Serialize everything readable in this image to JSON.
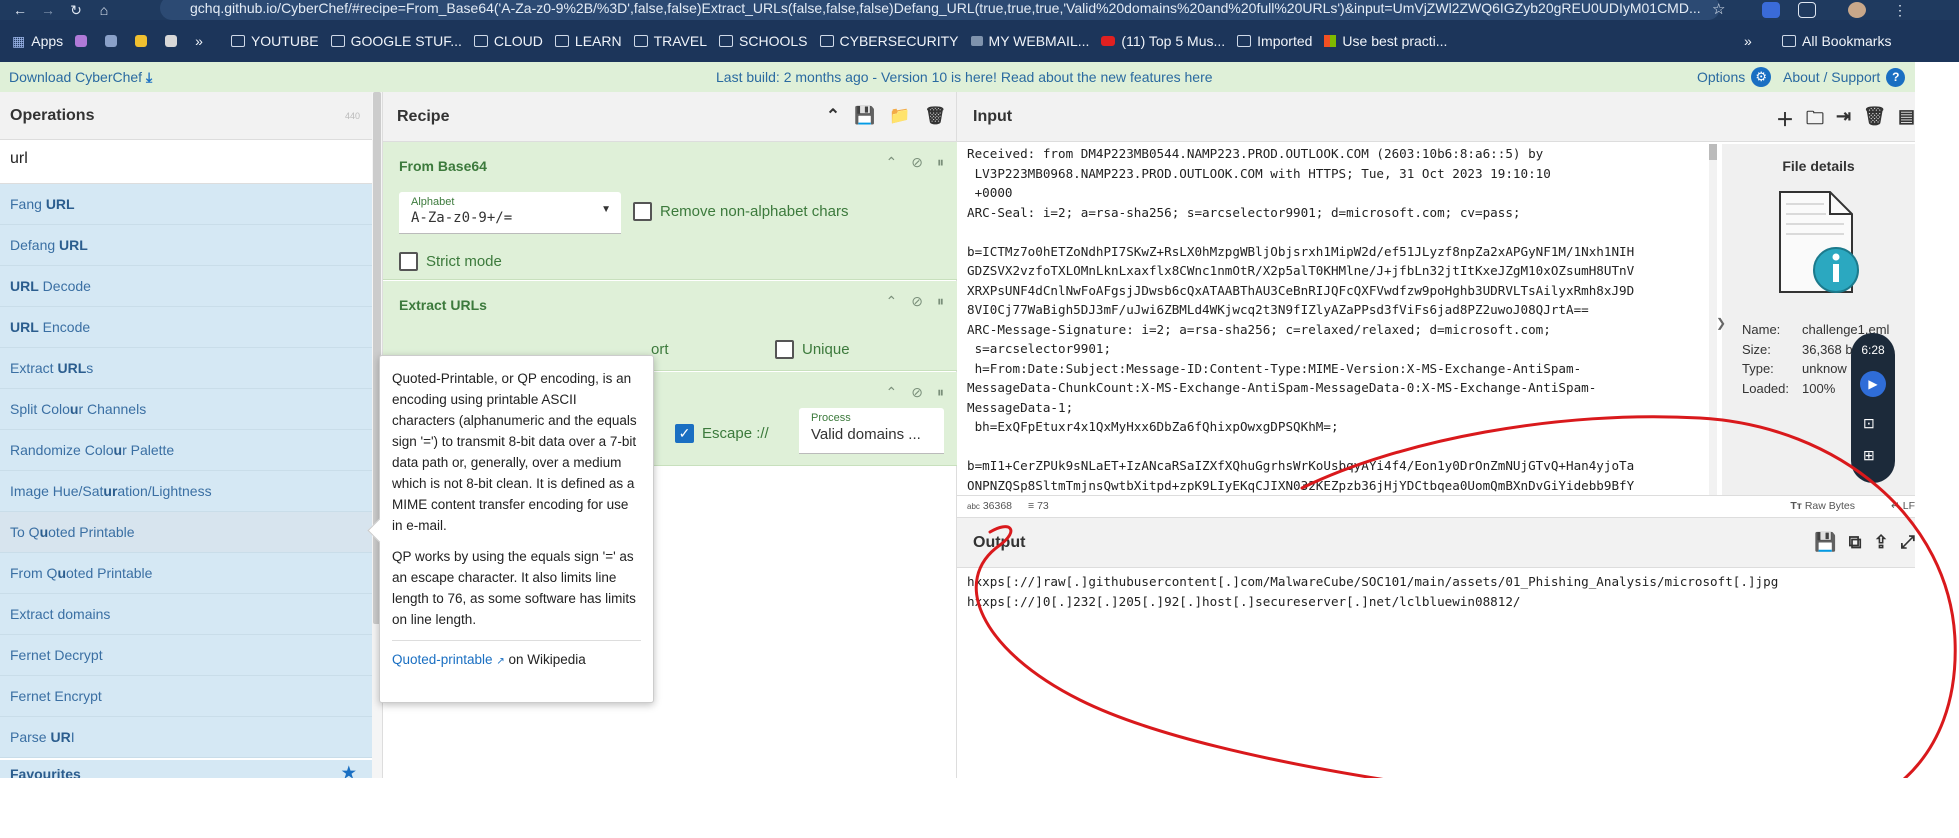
{
  "browser": {
    "url": "gchq.github.io/CyberChef/#recipe=From_Base64('A-Za-z0-9%2B/%3D',false,false)Extract_URLs(false,false,false)Defang_URL(true,true,true,'Valid%20domains%20and%20full%20URLs')&input=UmVjZWl2ZWQ6IGZyb20gREU0UDIyM01CMD..."
  },
  "bookmarks": [
    {
      "label": "Apps"
    },
    {
      "label": "YOUTUBE"
    },
    {
      "label": "GOOGLE STUF..."
    },
    {
      "label": "CLOUD"
    },
    {
      "label": "LEARN"
    },
    {
      "label": "TRAVEL"
    },
    {
      "label": "SCHOOLS"
    },
    {
      "label": "CYBERSECURITY"
    },
    {
      "label": "MY WEBMAIL..."
    },
    {
      "label": "(11) Top 5 Mus..."
    },
    {
      "label": "Imported"
    },
    {
      "label": "Use best practi..."
    },
    {
      "label": "All Bookmarks"
    }
  ],
  "banner": {
    "download": "Download CyberChef",
    "message": "Last build: 2 months ago - Version 10 is here! Read about the new features here",
    "options": "Options",
    "about": "About / Support"
  },
  "operations": {
    "title": "Operations",
    "count": "440",
    "search": "url",
    "items": [
      {
        "pre": "Fang ",
        "match": "URL",
        "post": ""
      },
      {
        "pre": "Defang ",
        "match": "URL",
        "post": ""
      },
      {
        "pre": "",
        "match": "URL",
        "post": " Decode"
      },
      {
        "pre": "",
        "match": "URL",
        "post": " Encode"
      },
      {
        "pre": "Extract ",
        "match": "URL",
        "post": "s"
      },
      {
        "pre": "Split Colo",
        "match": "u",
        "post": "r Channels"
      },
      {
        "pre": "Randomize Colo",
        "match": "u",
        "post": "r Palette"
      },
      {
        "pre": "Image Hue/Sat",
        "match": "ur",
        "post": "ation/Lightness"
      },
      {
        "pre": "To Q",
        "match": "u",
        "post": "oted Printable"
      },
      {
        "pre": "From Q",
        "match": "u",
        "post": "oted Printable"
      },
      {
        "pre": "Extract domains",
        "match": "",
        "post": ""
      },
      {
        "pre": "Fernet Decrypt",
        "match": "",
        "post": ""
      },
      {
        "pre": "Fernet Encrypt",
        "match": "",
        "post": ""
      },
      {
        "pre": "Parse ",
        "match": "UR",
        "post": "I"
      }
    ],
    "favourites": "Favourites"
  },
  "recipe": {
    "title": "Recipe",
    "from_base64": {
      "title": "From Base64",
      "alphabet_label": "Alphabet",
      "alphabet_value": "A-Za-z0-9+/=",
      "remove_label": "Remove non-alphabet chars",
      "strict_label": "Strict mode"
    },
    "extract_urls": {
      "title": "Extract URLs",
      "sort_label": "ort",
      "unique_label": "Unique"
    },
    "defang": {
      "escape_label": "Escape ://",
      "process_label": "Process",
      "process_value": "Valid domains ..."
    }
  },
  "popover": {
    "para1": "Quoted-Printable, or QP encoding, is an encoding using printable ASCII characters (alphanumeric and the equals sign '=') to transmit 8-bit data over a 7-bit data path or, generally, over a medium which is not 8-bit clean. It is defined as a MIME content transfer encoding for use in e-mail.",
    "para2": "QP works by using the equals sign '=' as an escape character. It also limits line length to 76, as some software has limits on line length.",
    "link": "Quoted-printable",
    "link_suffix": " on Wikipedia"
  },
  "input": {
    "title": "Input",
    "text": "Received: from DM4P223MB0544.NAMP223.PROD.OUTLOOK.COM (2603:10b6:8:a6::5) by\n LV3P223MB0968.NAMP223.PROD.OUTLOOK.COM with HTTPS; Tue, 31 Oct 2023 19:10:10\n +0000\nARC-Seal: i=2; a=rsa-sha256; s=arcselector9901; d=microsoft.com; cv=pass;\n\nb=ICTMz7o0hETZoNdhPI7SKwZ+RsLX0hMzpgWBljObjsrxh1MipW2d/ef51JLyzf8npZa2xAPGyNF1M/1Nxh1NIH\nGDZSVX2vzfoTXLOMnLknLxaxflx8CWnc1nmOtR/X2p5alT0KHMlne/J+jfbLn32jtItKxeJZgM10xOZsumH8UTnV\nXRXPsUNF4dCnlNwFoAFgsjJDwsb6cQxATAABThAU3CeBnRIJQFcQXFVwdfzw9poHghb3UDRVLTsAilyxRmh8xJ9D\n8VI0Cj77WaBigh5DJ3mF/uJwi6ZBMLd4WKjwcq2t3N9fIZlyAZaPPsd3fViFs6jad8PZ2uwoJ08QJrtA==\nARC-Message-Signature: i=2; a=rsa-sha256; c=relaxed/relaxed; d=microsoft.com;\n s=arcselector9901;\n h=From:Date:Subject:Message-ID:Content-Type:MIME-Version:X-MS-Exchange-AntiSpam-\nMessageData-ChunkCount:X-MS-Exchange-AntiSpam-MessageData-0:X-MS-Exchange-AntiSpam-\nMessageData-1;\n bh=ExQFpEtuxr4x1QxMyHxx6DbZa6fQhixpOwxgDPSQKhM=;\n\nb=mI1+CerZPUk9sNLaET+IzANcaRSaIZXfXQhuGgrhsWrKoUsbqyAYi4f4/Eon1y0DrOnZmNUjGTvQ+Han4yjoTa\nONPNZQSp8SltmTmjnsQwtbXitpd+zpK9LIyEKqCJIXN032KEZpzb36jHjYDCtbqea0UomQmBXnDvGiYidebb9BfY",
    "chars": "36368",
    "lines": "73",
    "raw_bytes": "Raw Bytes",
    "lf": "LF"
  },
  "file_details": {
    "title": "File details",
    "name_label": "Name:",
    "name_value": "challenge1.eml",
    "size_label": "Size:",
    "size_value": "36,368 b",
    "type_label": "Type:",
    "type_value": "unknow",
    "loaded_label": "Loaded:",
    "loaded_value": "100%"
  },
  "output": {
    "title": "Output",
    "line1": "hxxps[://]raw[.]githubusercontent[.]com/MalwareCube/SOC101/main/assets/01_Phishing_Analysis/microsoft[.]jpg",
    "line2": "hxxps[://]0[.]232[.]205[.]92[.]host[.]secureserver[.]net/lclbluewin08812/"
  },
  "widget": {
    "time": "6:28"
  },
  "colors": {
    "accent": "#1a6fc2",
    "ingredient_bg": "#dff0d8",
    "op_bg": "#d5e8f4",
    "annotation": "#d9191c"
  }
}
